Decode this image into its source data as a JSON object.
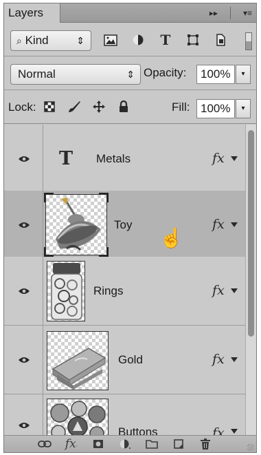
{
  "panel": {
    "tab_label": "Layers",
    "tab_extras": [
      "▸▸",
      "▾≡"
    ]
  },
  "filter": {
    "kind_label": "Kind",
    "kind_prefix_icon": "search-icon",
    "arrows": "⇕",
    "icons": [
      "pixel-filter-icon",
      "adjustment-filter-icon",
      "type-filter-icon",
      "shape-filter-icon",
      "smart-object-filter-icon"
    ]
  },
  "blend": {
    "mode": "Normal",
    "arrows": "⇕",
    "opacity_label": "Opacity:",
    "opacity_value": "100%",
    "drop": "▾"
  },
  "lock": {
    "label": "Lock:",
    "icons": [
      "lock-transparent-icon",
      "lock-image-icon",
      "lock-position-icon",
      "lock-all-icon"
    ],
    "fill_label": "Fill:",
    "fill_value": "100%",
    "drop": "▾"
  },
  "layers": [
    {
      "name": "Metals",
      "kind": "type",
      "fx": "fx",
      "selected": false
    },
    {
      "name": "Toy",
      "kind": "image",
      "fx": "fx",
      "selected": true
    },
    {
      "name": "Rings",
      "kind": "image",
      "fx": "fx",
      "selected": false
    },
    {
      "name": "Gold",
      "kind": "image",
      "fx": "fx",
      "selected": false
    },
    {
      "name": "Buttons",
      "kind": "image",
      "fx": "fx",
      "selected": false
    }
  ],
  "type_glyph": "T",
  "bottom_icons": [
    "link-layers-icon",
    "layer-style-icon",
    "add-mask-icon",
    "adjustment-layer-icon",
    "new-group-icon",
    "new-layer-icon",
    "delete-layer-icon"
  ],
  "colors": {
    "panel_bg": "#c9c9c9",
    "selected_row": "#b3b3b3",
    "border": "#7a7a7a"
  }
}
